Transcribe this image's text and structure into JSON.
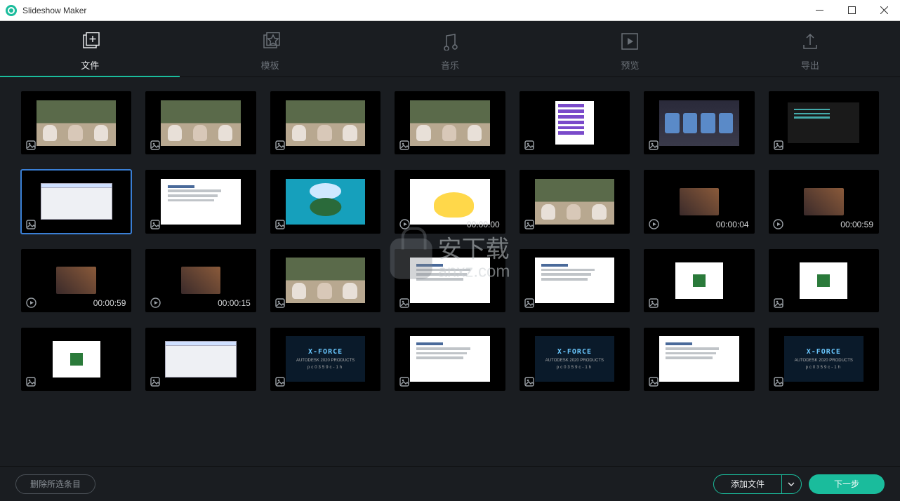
{
  "window": {
    "title": "Slideshow Maker"
  },
  "tabs": [
    {
      "label": "文件",
      "icon": "file-add-icon"
    },
    {
      "label": "模板",
      "icon": "template-icon"
    },
    {
      "label": "音乐",
      "icon": "music-icon"
    },
    {
      "label": "预览",
      "icon": "play-box-icon"
    },
    {
      "label": "导出",
      "icon": "export-icon"
    }
  ],
  "activeTab": 0,
  "thumbnails": [
    {
      "type": "image",
      "art": "puppies",
      "selected": false
    },
    {
      "type": "image",
      "art": "puppies",
      "selected": false
    },
    {
      "type": "image",
      "art": "puppies",
      "selected": false
    },
    {
      "type": "image",
      "art": "puppies",
      "selected": false
    },
    {
      "type": "image",
      "art": "menu",
      "selected": false
    },
    {
      "type": "image",
      "art": "cars",
      "selected": false
    },
    {
      "type": "image",
      "art": "dark",
      "selected": false
    },
    {
      "type": "image",
      "art": "dialog",
      "selected": true
    },
    {
      "type": "image",
      "art": "whitedoc",
      "selected": false
    },
    {
      "type": "image",
      "art": "cyan",
      "selected": false
    },
    {
      "type": "video",
      "art": "chick",
      "duration": "00:00:00",
      "selected": false
    },
    {
      "type": "image",
      "art": "puppies",
      "selected": false
    },
    {
      "type": "video",
      "art": "movie",
      "duration": "00:00:04",
      "selected": false
    },
    {
      "type": "video",
      "art": "movie",
      "duration": "00:00:59",
      "selected": false
    },
    {
      "type": "video",
      "art": "movie",
      "duration": "00:00:59",
      "selected": false
    },
    {
      "type": "video",
      "art": "movie",
      "duration": "00:00:15",
      "selected": false
    },
    {
      "type": "image",
      "art": "puppies",
      "selected": false
    },
    {
      "type": "image",
      "art": "whitedoc",
      "selected": false
    },
    {
      "type": "image",
      "art": "whitedoc",
      "selected": false
    },
    {
      "type": "image",
      "art": "dw",
      "selected": false
    },
    {
      "type": "image",
      "art": "dw",
      "selected": false
    },
    {
      "type": "image",
      "art": "dw",
      "selected": false
    },
    {
      "type": "image",
      "art": "dialog",
      "selected": false
    },
    {
      "type": "image",
      "art": "xforce",
      "selected": false
    },
    {
      "type": "image",
      "art": "whitedoc",
      "selected": false
    },
    {
      "type": "image",
      "art": "xforce",
      "selected": false
    },
    {
      "type": "image",
      "art": "whitedoc",
      "selected": false
    },
    {
      "type": "image",
      "art": "xforce",
      "selected": false
    }
  ],
  "xforce": {
    "title": "X-FORCE",
    "sub": "AUTODESK 2020 PRODUCTS",
    "code": "pc0359c-1h"
  },
  "footer": {
    "deleteLabel": "删除所选条目",
    "addLabel": "添加文件",
    "nextLabel": "下一步"
  },
  "watermark": {
    "text1": "安下载",
    "text2": "anxz.com"
  }
}
